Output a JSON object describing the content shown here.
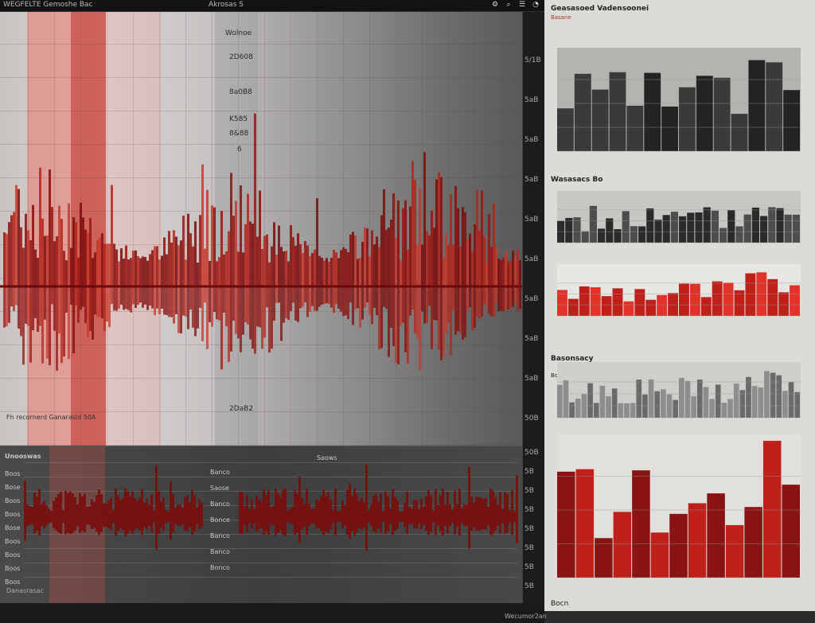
{
  "topbar": {
    "app_title": "WEGFELTE Gemoshe Bac",
    "center_label": "Akrosas S",
    "icons": [
      "gear-icon",
      "search-icon",
      "settings-icon",
      "bell-icon"
    ]
  },
  "main_wave": {
    "labels": [
      "Wolnoe",
      "2D608",
      "8a0B8",
      "K585",
      "8&88",
      "6",
      "2DaB2"
    ],
    "note": "Fh recornerd Ganarasld 50A",
    "right_axis": [
      "5/1B",
      "5aB",
      "5aB",
      "5aB",
      "5aB",
      "5aB",
      "5aB",
      "5aB",
      "5aB",
      "50B"
    ]
  },
  "lower_lanes": {
    "header": "Unooswas",
    "labels": [
      "Boos",
      "Bose",
      "Boos",
      "Boos",
      "Bose",
      "Boos",
      "Boos",
      "Boos",
      "Boos"
    ],
    "mid_labels": [
      "Banco",
      "Saose",
      "Banco",
      "Bonce",
      "Banco",
      "Banco",
      "Bonco"
    ],
    "column_header": "Saows",
    "right_axis": [
      "50B",
      "5B",
      "5B",
      "5B",
      "5B",
      "5B",
      "5B",
      "5B"
    ],
    "footer_left": "Danasrasac",
    "footer_right": "Wecumor2an"
  },
  "right_panels": {
    "panel1_title": "Geasasoed Vadensoonei",
    "panel1_sub": "Basane",
    "panel2_title": "Wasasacs Bo",
    "panel3_title": "Basonsacy",
    "panel3_sub": "Boenaes",
    "panel4_footer": "Bocn"
  },
  "colors": {
    "dark_red": "#7a0c0c",
    "red": "#c0201a",
    "bright_red": "#e0342a",
    "dark": "#232323",
    "gray": "#5a5a5a"
  }
}
